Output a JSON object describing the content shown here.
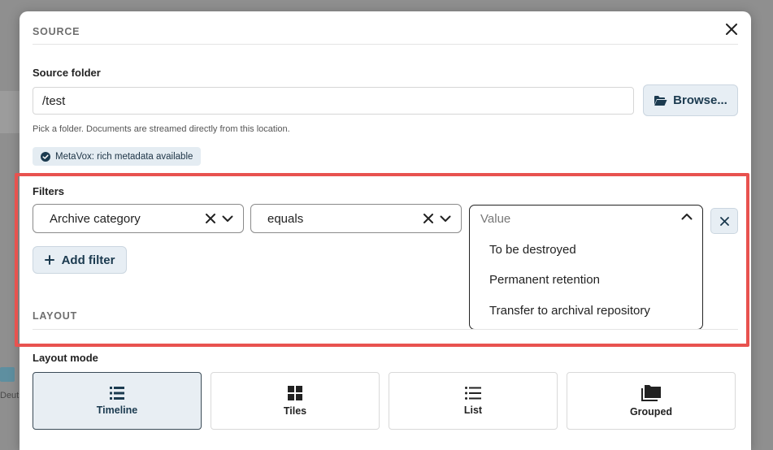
{
  "background": {
    "partial_text": "Deuts"
  },
  "modal": {
    "source_header": "SOURCE",
    "source_folder_label": "Source folder",
    "source_folder_value": "/test",
    "browse_label": "Browse...",
    "hint": "Pick a folder. Documents are streamed directly from this location.",
    "metavox_badge": "MetaVox: rich metadata available",
    "filters_label": "Filters",
    "filter_field": "Archive category",
    "filter_operator": "equals",
    "filter_value_placeholder": "Value",
    "filter_options": [
      "To be destroyed",
      "Permanent retention",
      "Transfer to archival repository"
    ],
    "add_filter_label": "Add filter",
    "layout_header": "LAYOUT",
    "layout_mode_label": "Layout mode",
    "layout_modes": [
      {
        "label": "Timeline",
        "icon": "timeline-list-icon",
        "selected": true
      },
      {
        "label": "Tiles",
        "icon": "tiles-grid-icon",
        "selected": false
      },
      {
        "label": "List",
        "icon": "list-icon",
        "selected": false
      },
      {
        "label": "Grouped",
        "icon": "folders-icon",
        "selected": false
      }
    ]
  },
  "colors": {
    "accent_button_bg": "#e7eef4",
    "text_dark": "#1b3a4f",
    "highlight_border": "#e8524f"
  }
}
